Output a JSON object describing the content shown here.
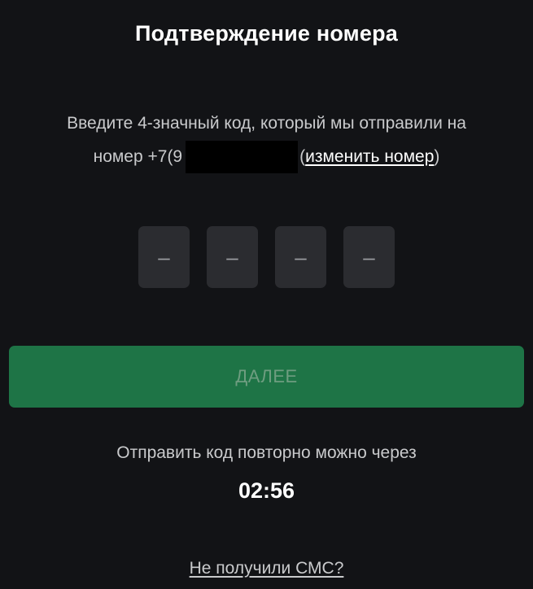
{
  "header": {
    "title": "Подтверждение номера"
  },
  "instructions": {
    "line1": "Введите 4-значный код, который мы отправили на",
    "line2_prefix": "номер +7(9",
    "open_paren": "(",
    "change_link": "изменить номер",
    "close_paren": ")"
  },
  "code_input": {
    "cells": [
      "–",
      "–",
      "–",
      "–"
    ]
  },
  "next_button": {
    "label": "ДАЛЕЕ"
  },
  "resend": {
    "text": "Отправить код повторно можно через",
    "timer": "02:56"
  },
  "footer": {
    "no_sms_link": "Не получили СМС?"
  },
  "colors": {
    "background": "#121316",
    "button_bg": "#1e7446",
    "button_text": "#6e9d80",
    "code_cell_bg": "#2b2c30"
  }
}
